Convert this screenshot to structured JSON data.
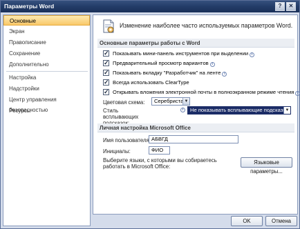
{
  "window": {
    "title": "Параметры Word",
    "help_glyph": "?",
    "close_glyph": "✕"
  },
  "sidebar": {
    "items": [
      {
        "label": "Основные"
      },
      {
        "label": "Экран"
      },
      {
        "label": "Правописание"
      },
      {
        "label": "Сохранение"
      },
      {
        "label": "Дополнительно"
      },
      {
        "label": "Настройка"
      },
      {
        "label": "Надстройки"
      },
      {
        "label": "Центр управления безопасностью"
      },
      {
        "label": "Ресурсы"
      }
    ]
  },
  "main": {
    "header": "Изменение наиболее часто используемых параметров Word.",
    "section1": {
      "title": "Основные параметры работы с Word",
      "checkboxes": [
        {
          "label": "Показывать мини-панель инструментов при выделении",
          "checked": "✓",
          "info": "i"
        },
        {
          "label": "Предварительный просмотр вариантов",
          "checked": "✓",
          "info": "i"
        },
        {
          "label": "Показывать вкладку \"Разработчик\" на ленте",
          "checked": "✓",
          "info": "i"
        },
        {
          "label": "Всегда использовать ClearType",
          "checked": "✓",
          "info": ""
        },
        {
          "label": "Открывать вложения электронной почты в полноэкранном режиме чтения",
          "checked": "✓",
          "info": "i"
        }
      ],
      "color_scheme_label": "Цветовая схема:",
      "color_scheme_value": "Серебристая",
      "tooltip_style_label": "Стиль всплывающих подсказок:",
      "tooltip_style_value": "Не показывать всплывающие подсказки",
      "info_glyph": "i",
      "arrow_glyph": "▼"
    },
    "section2": {
      "title": "Личная настройка Microsoft Office",
      "username_label": "Имя пользователя:",
      "username_value": "АБВГД",
      "initials_label": "Инициалы:",
      "initials_value": "ФИО",
      "languages_text": "Выберите языки, с которыми вы собираетесь работать в Microsoft Office:",
      "languages_button": "Языковые параметры..."
    }
  },
  "footer": {
    "ok": "OK",
    "cancel": "Отмена"
  }
}
